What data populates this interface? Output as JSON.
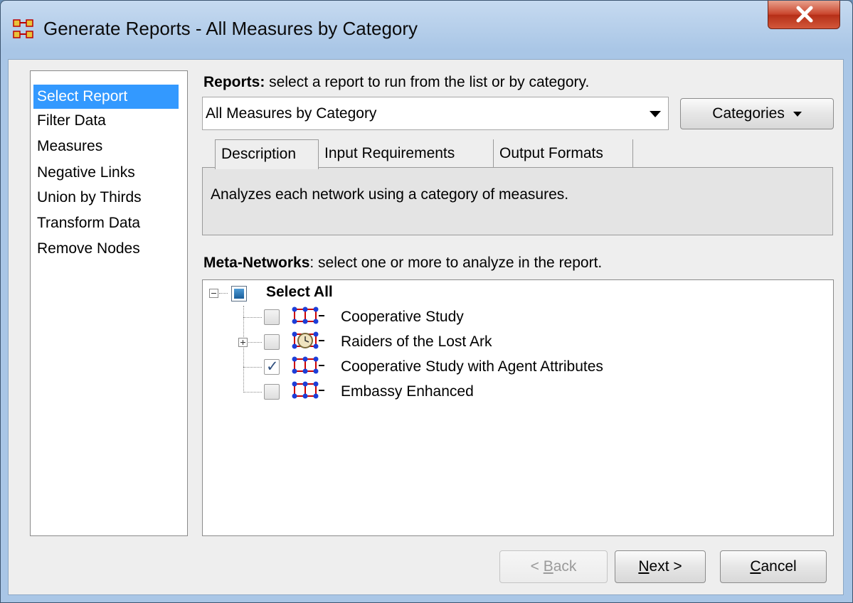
{
  "window": {
    "title": "Generate Reports - All Measures by Category"
  },
  "nav": {
    "items": [
      {
        "label": "Select Report",
        "selected": true
      },
      {
        "label": "Filter Data"
      },
      {
        "label": "Measures"
      },
      {
        "label": "Negative Links"
      },
      {
        "label": "Union by Thirds"
      },
      {
        "label": "Transform Data"
      },
      {
        "label": "Remove Nodes"
      }
    ]
  },
  "reports": {
    "label_bold": "Reports:",
    "label_rest": " select a report to run from the list or by category.",
    "selected": "All Measures by Category",
    "categories_button": "Categories"
  },
  "tabs": [
    {
      "label": "Description",
      "active": true
    },
    {
      "label": "Input Requirements"
    },
    {
      "label": "Output Formats"
    }
  ],
  "description": "Analyzes each network using a category of measures.",
  "metanetworks": {
    "label_bold": "Meta-Networks",
    "label_rest": ": select one or more to analyze in the report.",
    "select_all": "Select All",
    "items": [
      {
        "label": "Cooperative Study",
        "checked": false,
        "expandable": false
      },
      {
        "label": "Raiders of the Lost Ark",
        "checked": false,
        "expandable": true
      },
      {
        "label": "Cooperative Study with Agent Attributes",
        "checked": true,
        "expandable": false
      },
      {
        "label": "Embassy Enhanced",
        "checked": false,
        "expandable": false
      }
    ]
  },
  "buttons": {
    "back": {
      "mnemonic": "B",
      "rest": "ack",
      "prefix": "< "
    },
    "next": {
      "mnemonic": "N",
      "rest": "ext >"
    },
    "cancel": {
      "mnemonic": "C",
      "rest": "ancel"
    }
  },
  "colors": {
    "selection": "#3399ff",
    "close": "#c9432a"
  }
}
